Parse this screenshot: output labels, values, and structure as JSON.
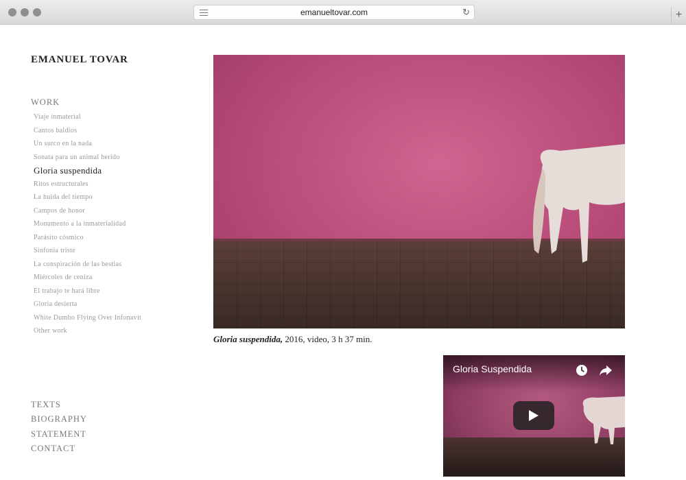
{
  "browser": {
    "url": "emanueltovar.com",
    "new_tab_label": "+"
  },
  "sidebar": {
    "site_title": "EMANUEL TOVAR",
    "work_heading": "WORK",
    "work_items": [
      "Viaje inmaterial",
      "Cantos baldíos",
      "Un surco en la nada",
      "Sonata para un animal herido",
      "Gloria suspendida",
      "Ritos estructurales",
      "La huida del tiempo",
      "Campos de honor",
      "Monumento a la inmaterialidad",
      "Parásito cósmico",
      "Sinfonía triste",
      "La conspiración de las bestias",
      "Miércoles de ceniza",
      "El trabajo te hará libre",
      "Gloria desierta",
      "White Dumbo Flying Over Infonavit",
      "Other work"
    ],
    "active_index": 4,
    "bottom_nav": [
      "TEXTS",
      "BIOGRAPHY",
      "STATEMENT",
      "CONTACT"
    ]
  },
  "main": {
    "caption_title": "Gloria suspendida,",
    "caption_rest": " 2016, video, 3 h 37 min.",
    "video": {
      "title": "Gloria Suspendida",
      "icons": [
        "clock-icon",
        "share-icon",
        "play-icon"
      ]
    }
  },
  "colors": {
    "wall_pink": "#c0527f",
    "floor_brown": "#4a332e",
    "text_dark": "#222222",
    "text_muted": "#999999"
  }
}
